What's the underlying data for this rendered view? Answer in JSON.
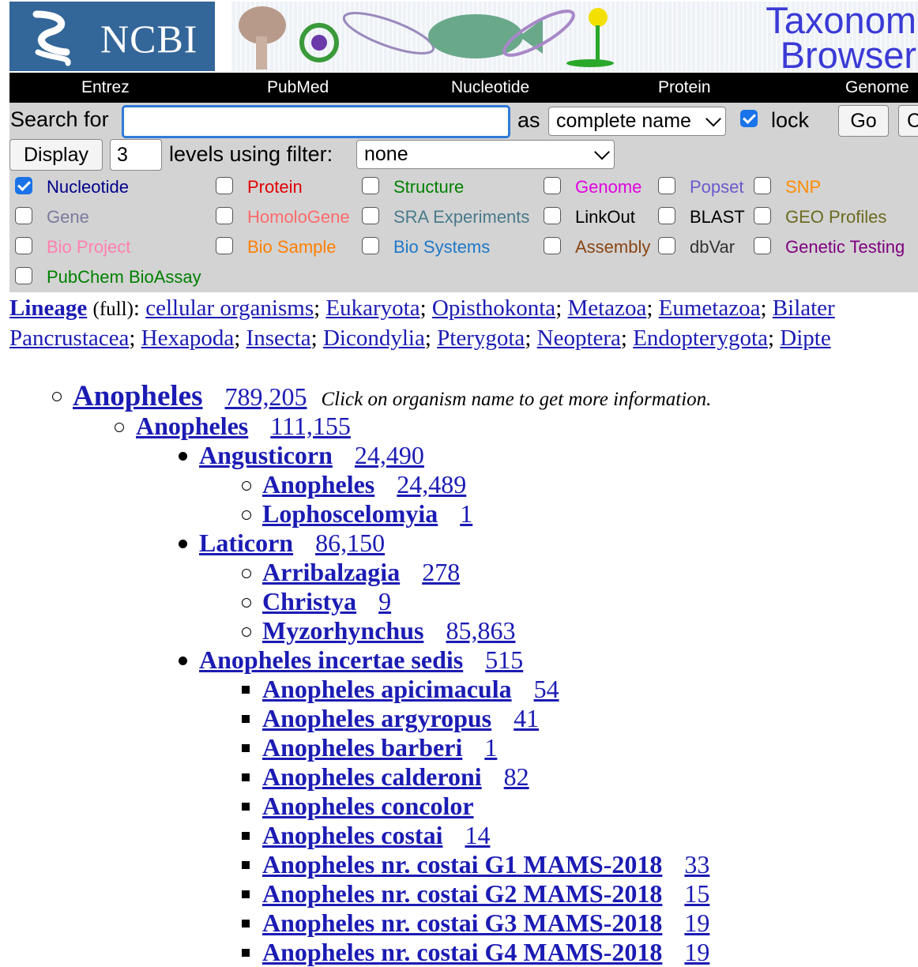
{
  "banner": {
    "logo_text": "NCBI",
    "title_line1": "Taxonom",
    "title_line2": "Browser"
  },
  "nav": [
    "Entrez",
    "PubMed",
    "Nucleotide",
    "Protein",
    "Genome"
  ],
  "search": {
    "label": "Search for",
    "value": "",
    "as_label": "as",
    "as_value": "complete name",
    "lock_label": "lock",
    "lock_checked": true,
    "go_label": "Go",
    "clear_label": "C"
  },
  "display": {
    "button_label": "Display",
    "levels_value": "3",
    "levels_label": "levels using filter:",
    "filter_value": "none"
  },
  "databases": [
    {
      "label": "Nucleotide",
      "checked": true,
      "color": "#00008b"
    },
    {
      "label": "Protein",
      "checked": false,
      "color": "#e00000"
    },
    {
      "label": "Structure",
      "checked": false,
      "color": "#008000"
    },
    {
      "label": "Genome",
      "checked": false,
      "color": "#e000e0"
    },
    {
      "label": "Popset",
      "checked": false,
      "color": "#6a5acd"
    },
    {
      "label": "SNP",
      "checked": false,
      "color": "#ff8c00"
    },
    {
      "label": "Gene",
      "checked": false,
      "color": "#7b7b9e"
    },
    {
      "label": "HomoloGene",
      "checked": false,
      "color": "#ff6a6a"
    },
    {
      "label": "SRA Experiments",
      "checked": false,
      "color": "#4a7a8c"
    },
    {
      "label": "LinkOut",
      "checked": false,
      "color": "#000000"
    },
    {
      "label": "BLAST",
      "checked": false,
      "color": "#000000"
    },
    {
      "label": "GEO Profiles",
      "checked": false,
      "color": "#6b6b20"
    },
    {
      "label": "Bio Project",
      "checked": false,
      "color": "#ff7fb0"
    },
    {
      "label": "Bio Sample",
      "checked": false,
      "color": "#ff7f00"
    },
    {
      "label": "Bio Systems",
      "checked": false,
      "color": "#1e78c8"
    },
    {
      "label": "Assembly",
      "checked": false,
      "color": "#8b4513"
    },
    {
      "label": "dbVar",
      "checked": false,
      "color": "#333333"
    },
    {
      "label": "Genetic Testing",
      "checked": false,
      "color": "#800080"
    },
    {
      "label": "PubChem BioAssay",
      "checked": false,
      "color": "#008000"
    }
  ],
  "lineage": {
    "label": "Lineage",
    "full": "(full)",
    "line1": [
      "cellular organisms",
      "Eukaryota",
      "Opisthokonta",
      "Metazoa",
      "Eumetazoa",
      "Bilater"
    ],
    "line2": [
      "Pancrustacea",
      "Hexapoda",
      "Insecta",
      "Dicondylia",
      "Pterygota",
      "Neoptera",
      "Endopterygota",
      "Dipte"
    ]
  },
  "tree_note": "Click on organism name to get more information.",
  "tree": [
    {
      "name": "Anopheles",
      "count": "789,205",
      "level": 0,
      "bullet": "circle"
    },
    {
      "name": "Anopheles",
      "count": "111,155",
      "level": 1,
      "bullet": "circle"
    },
    {
      "name": "Angusticorn",
      "count": "24,490",
      "level": 2,
      "bullet": "disc"
    },
    {
      "name": "Anopheles",
      "count": "24,489",
      "level": 3,
      "bullet": "circle"
    },
    {
      "name": "Lophoscelomyia",
      "count": "1",
      "level": 3,
      "bullet": "circle"
    },
    {
      "name": "Laticorn",
      "count": "86,150",
      "level": 2,
      "bullet": "disc"
    },
    {
      "name": "Arribalzagia",
      "count": "278",
      "level": 3,
      "bullet": "circle"
    },
    {
      "name": "Christya",
      "count": "9",
      "level": 3,
      "bullet": "circle"
    },
    {
      "name": "Myzorhynchus",
      "count": "85,863",
      "level": 3,
      "bullet": "circle"
    },
    {
      "name": "Anopheles incertae sedis",
      "count": "515",
      "level": 2,
      "bullet": "disc"
    },
    {
      "name": "Anopheles apicimacula",
      "count": "54",
      "level": 3,
      "bullet": "square"
    },
    {
      "name": "Anopheles argyropus",
      "count": "41",
      "level": 3,
      "bullet": "square"
    },
    {
      "name": "Anopheles barberi",
      "count": "1",
      "level": 3,
      "bullet": "square"
    },
    {
      "name": "Anopheles calderoni",
      "count": "82",
      "level": 3,
      "bullet": "square"
    },
    {
      "name": "Anopheles concolor",
      "count": "",
      "level": 3,
      "bullet": "square"
    },
    {
      "name": "Anopheles costai",
      "count": "14",
      "level": 3,
      "bullet": "square"
    },
    {
      "name": "Anopheles nr. costai G1 MAMS-2018",
      "count": "33",
      "level": 3,
      "bullet": "square"
    },
    {
      "name": "Anopheles nr. costai G2 MAMS-2018",
      "count": "15",
      "level": 3,
      "bullet": "square"
    },
    {
      "name": "Anopheles nr. costai G3 MAMS-2018",
      "count": "19",
      "level": 3,
      "bullet": "square"
    },
    {
      "name": "Anopheles nr. costai G4 MAMS-2018",
      "count": "19",
      "level": 3,
      "bullet": "square"
    }
  ]
}
